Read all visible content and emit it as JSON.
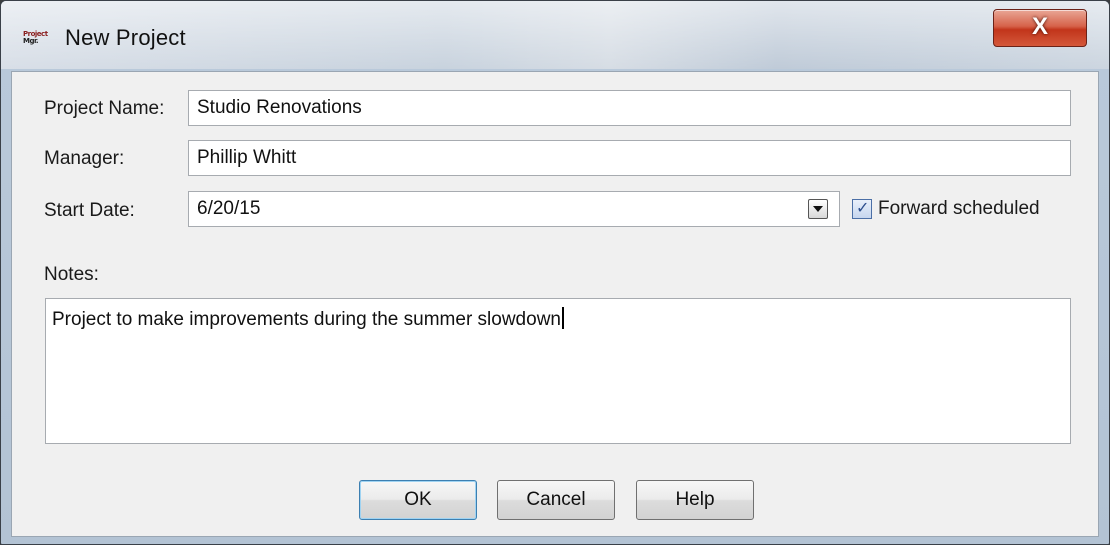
{
  "window": {
    "title": "New Project",
    "close_label": "X"
  },
  "form": {
    "project_name_label": "Project Name:",
    "project_name_value": "Studio Renovations",
    "manager_label": "Manager:",
    "manager_value": "Phillip Whitt",
    "start_date_label": "Start Date:",
    "start_date_value": "6/20/15",
    "forward_scheduled_label": "Forward scheduled",
    "forward_scheduled_checked": true,
    "notes_label": "Notes:",
    "notes_value": "Project to make improvements during the summer slowdown"
  },
  "buttons": {
    "ok": "OK",
    "cancel": "Cancel",
    "help": "Help"
  }
}
